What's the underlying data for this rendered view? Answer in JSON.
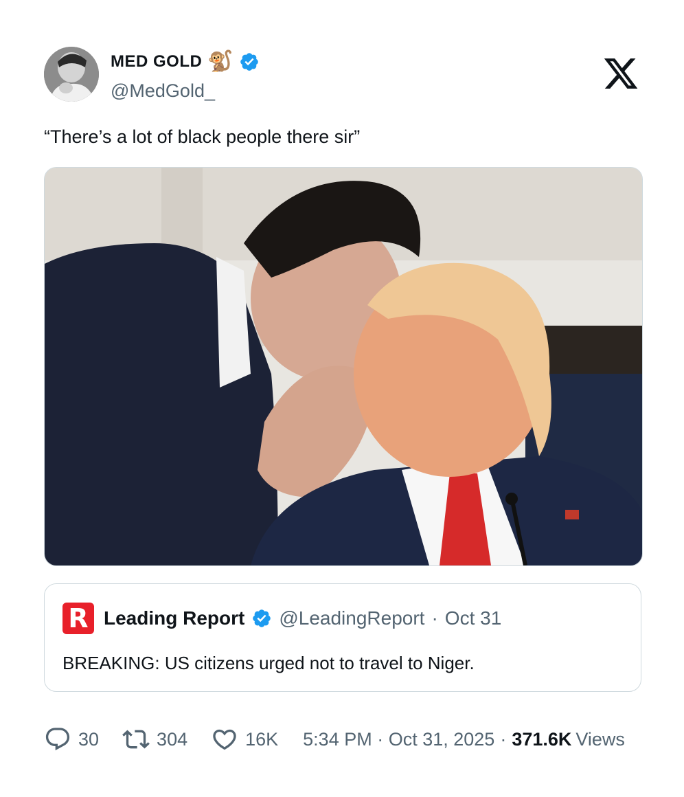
{
  "author": {
    "display_name": "MED GOLD",
    "handle": "@MedGold_",
    "emoji": "🐒",
    "verified": true
  },
  "brand": {
    "logo": "x-logo-icon"
  },
  "tweet": {
    "text": "“There’s a lot of black people there sir”"
  },
  "quoted_tweet": {
    "name": "Leading Report",
    "logo_letter": "R",
    "handle": "@LeadingReport",
    "separator": "·",
    "date": "Oct 31",
    "text": "BREAKING: US citizens urged not to travel to Niger."
  },
  "stats": {
    "replies": "30",
    "retweets": "304",
    "likes": "16K",
    "time": "5:34 PM · Oct 31, 2025",
    "separator": "·",
    "views_count": "371.6K",
    "views_label": "Views"
  },
  "colors": {
    "verified_blue": "#1d9bf0",
    "secondary_text": "#536471",
    "border": "#cfd9de",
    "leading_report_red": "#e8202a"
  }
}
